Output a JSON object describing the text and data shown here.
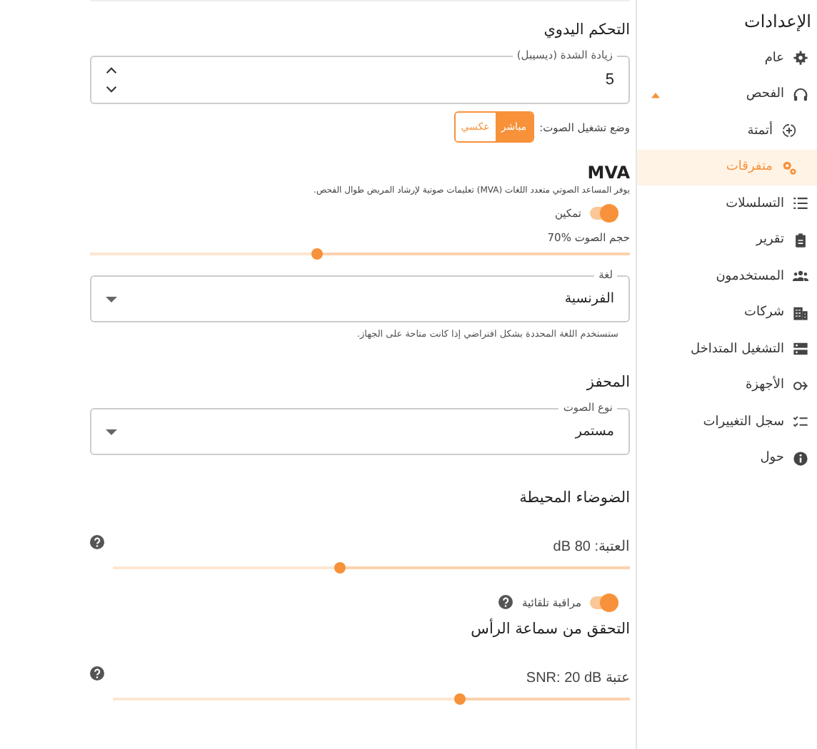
{
  "sidebar": {
    "title": "الإعدادات",
    "items": [
      {
        "label": "عام",
        "selected": false
      },
      {
        "label": "الفحص",
        "selected": false,
        "expanded": true,
        "children": [
          {
            "label": "أتمتة",
            "selected": false
          },
          {
            "label": "متفرقات",
            "selected": true
          }
        ]
      },
      {
        "label": "التسلسلات",
        "selected": false
      },
      {
        "label": "تقرير",
        "selected": false
      },
      {
        "label": "المستخدمون",
        "selected": false
      },
      {
        "label": "شركات",
        "selected": false
      },
      {
        "label": "التشغيل المتداخل",
        "selected": false
      },
      {
        "label": "الأجهزة",
        "selected": false
      },
      {
        "label": "سجل التغييرات",
        "selected": false
      },
      {
        "label": "حول",
        "selected": false
      }
    ]
  },
  "manual": {
    "heading": "التحكم اليدوي",
    "gain": {
      "label": "زيادة الشدة (ديسيبل)",
      "value": "5"
    },
    "mode": {
      "label": "وضع تشغيل الصوت:",
      "options": [
        {
          "label": "مباشر",
          "selected": true
        },
        {
          "label": "عكسي",
          "selected": false
        }
      ]
    }
  },
  "mva": {
    "heading": "MVA",
    "description": "يوفر المساعد الصوتي متعدد اللغات (MVA) تعليمات صوتية لإرشاد المريض طوال الفحص.",
    "enable": {
      "label": "تمكين",
      "on": true
    },
    "volume": {
      "label": "حجم الصوت %70",
      "level": 0.58
    },
    "language": {
      "label": "لغة",
      "value": "الفرنسية",
      "helper": "ستستخدم اللغة المحددة بشكل افتراضي إذا كانت متاحة على الجهاز."
    }
  },
  "trigger": {
    "heading": "المحفز",
    "sound_type": {
      "label": "نوع الصوت",
      "value": "مستمر"
    }
  },
  "ambient": {
    "heading": "الضوضاء المحيطة",
    "threshold": {
      "label": "العتبة: 80 dB",
      "level": 0.56
    },
    "auto_monitor": {
      "label": "مراقبة تلقائية",
      "on": true
    }
  },
  "headset": {
    "heading": "التحقق من سماعة الرأس",
    "snr": {
      "label": "عتبة SNR: 20 dB",
      "level": 0.33
    }
  }
}
